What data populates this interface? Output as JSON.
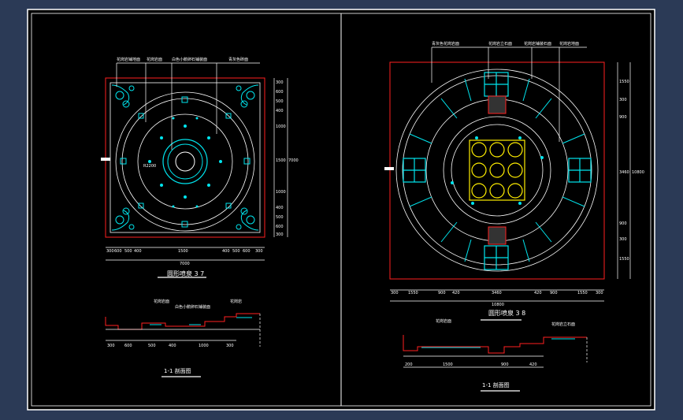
{
  "drawing": {
    "left_panel": {
      "title": "圆形喷泉 3 7",
      "section_title": "1-1 剖面图",
      "callouts": [
        "花岗岩铺地面",
        "花岗岩面",
        "白色小鹅卵石铺装面",
        "青灰色砖面"
      ],
      "section_callouts": [
        "花岗岩面",
        "白色小鹅卵石铺装面",
        "花岗岩"
      ],
      "dim_bottom": [
        "300",
        "600",
        "500",
        "400",
        "1500",
        "400",
        "500",
        "600",
        "300"
      ],
      "dim_bottom_total": "7000",
      "dim_right": [
        "300",
        "600",
        "500",
        "400",
        "1000",
        "1500",
        "1000",
        "400",
        "500",
        "600",
        "300"
      ],
      "dim_right_total": "7000",
      "dim_section": [
        "300",
        "600",
        "500",
        "400",
        "1000",
        "300"
      ],
      "radius_label": "R2200"
    },
    "right_panel": {
      "title": "圆形喷泉 3 8",
      "section_title": "1-1 剖面图",
      "callouts": [
        "青灰色花岗岩面",
        "花岗岩立石面",
        "花岗岩铺装石面",
        "花岗岩地面"
      ],
      "section_callouts": [
        "花岗岩面",
        "花岗岩立石面"
      ],
      "dim_bottom": [
        "300",
        "1550",
        "900",
        "420",
        "3460",
        "420",
        "900",
        "1550",
        "300"
      ],
      "dim_bottom_total": "10800",
      "dim_right": [
        "1550",
        "300",
        "900",
        "3460",
        "900",
        "300",
        "1550"
      ],
      "dim_right_total": "10800",
      "dim_section": [
        "200",
        "1500",
        "900",
        "420"
      ]
    }
  },
  "colors": {
    "background": "#2b3a56",
    "paper": "#000000",
    "frame_line": "#ffffff",
    "cyan": "#00e5ee",
    "red": "#ff2020",
    "yellow": "#ffee00",
    "white": "#ffffff"
  }
}
